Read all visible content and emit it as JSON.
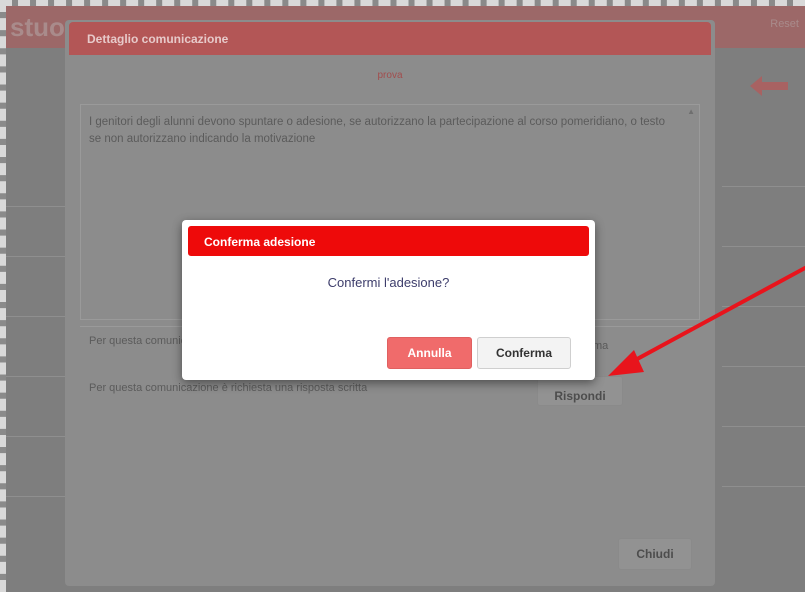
{
  "background": {
    "header_title": "stuo",
    "header_right": "Reset"
  },
  "detail": {
    "title": "Dettaglio comunicazione",
    "subject": "prova",
    "body": "I genitori degli alunni devono spuntare o adesione, se autorizzano la partecipazione al corso pomeridiano, o testo se non autorizzano indicando la motivazione",
    "line1_left": "Per questa comunicazione è richiesta la conferma",
    "line1_right": "ma",
    "line2": "Per questa comunicazione è richiesta una risposta scritta",
    "reply_label": "Rispondi",
    "close_label": "Chiudi"
  },
  "confirm": {
    "title": "Conferma adesione",
    "question": "Confermi l'adesione?",
    "cancel_label": "Annulla",
    "confirm_label": "Conferma"
  },
  "colors": {
    "confirm_header": "#ee0a0a",
    "cancel_button": "#f06b6b",
    "annotation_arrow": "#e8141c"
  },
  "icons": {
    "back": "back-arrow-icon",
    "annotation": "annotation-arrow-icon"
  }
}
